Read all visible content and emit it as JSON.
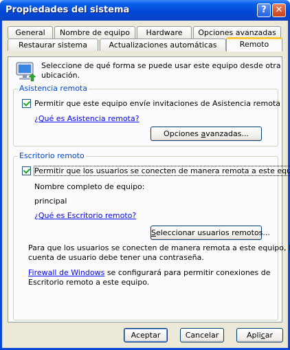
{
  "window": {
    "title": "Propiedades del sistema"
  },
  "tabs_top": [
    {
      "label": "General"
    },
    {
      "label": "Nombre de equipo"
    },
    {
      "label": "Hardware"
    },
    {
      "label": "Opciones avanzadas"
    }
  ],
  "tabs_bottom": [
    {
      "label": "Restaurar sistema"
    },
    {
      "label": "Actualizaciones automáticas"
    },
    {
      "label": "Remoto"
    }
  ],
  "intro": {
    "line1": "Seleccione de qué forma se puede usar este equipo desde otra",
    "line2": "ubicación."
  },
  "asistencia": {
    "label": "Asistencia remota",
    "checkbox_label": "Permitir que este equipo envíe invitaciones de Asistencia remota",
    "checked": true,
    "link": "¿Qué es Asistencia remota?",
    "button_pre": "Opciones ",
    "button_u": "a",
    "button_post": "vanzadas..."
  },
  "escritorio": {
    "label": "Escritorio remoto",
    "checkbox_label": "Permitir que los usuarios se conecten de manera remota a este equipo",
    "checked": true,
    "computer_name_label": "Nombre completo de equipo:",
    "computer_name": "principal",
    "link": "¿Qué es Escritorio remoto?",
    "button_u": "S",
    "button_post": "eleccionar usuarios remotos...",
    "note_line1": "Para que los usuarios se conecten de manera remota a este equipo, la",
    "note_line2": "cuenta de usuario debe tener una contraseña.",
    "firewall_link": "Firewall de Windows",
    "firewall_line1_rest": " se configurará para permitir conexiones de",
    "firewall_line2": "Escritorio remoto a este equipo."
  },
  "footer": {
    "ok": "Aceptar",
    "cancel": "Cancelar",
    "apply_pre": "Apli",
    "apply_u": "c",
    "apply_post": "ar"
  }
}
